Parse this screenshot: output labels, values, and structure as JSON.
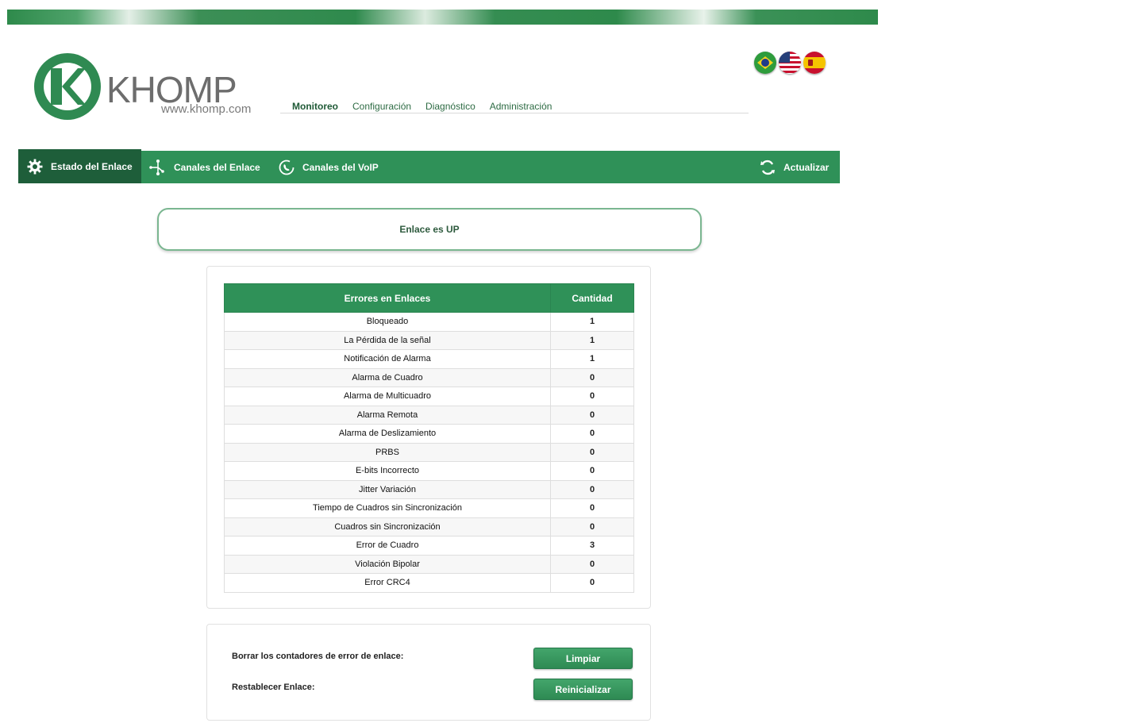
{
  "brand": {
    "name": "KHOMP",
    "url": "www.khomp.com"
  },
  "languages": [
    {
      "name": "brazil-flag-icon"
    },
    {
      "name": "usa-flag-icon"
    },
    {
      "name": "spain-flag-icon"
    }
  ],
  "main_nav": [
    {
      "label": "Monitoreo",
      "active": true
    },
    {
      "label": "Configuración"
    },
    {
      "label": "Diagnóstico"
    },
    {
      "label": "Administración"
    }
  ],
  "sub_nav": {
    "tabs": [
      {
        "label": "Estado del Enlace",
        "icon": "gear-icon",
        "active": true
      },
      {
        "label": "Canales del Enlace",
        "icon": "branch-icon"
      },
      {
        "label": "Canales del VoIP",
        "icon": "phone-cycle-icon"
      }
    ],
    "refresh_label": "Actualizar",
    "refresh_icon": "refresh-icon"
  },
  "status": {
    "text": "Enlace es UP"
  },
  "errors_table": {
    "headers": [
      "Errores en Enlaces",
      "Cantidad"
    ],
    "rows": [
      {
        "name": "Bloqueado",
        "count": "1"
      },
      {
        "name": "La Pérdida de la señal",
        "count": "1"
      },
      {
        "name": "Notificación de Alarma",
        "count": "1"
      },
      {
        "name": "Alarma de Cuadro",
        "count": "0"
      },
      {
        "name": "Alarma de Multicuadro",
        "count": "0"
      },
      {
        "name": "Alarma Remota",
        "count": "0"
      },
      {
        "name": "Alarma de Deslizamiento",
        "count": "0"
      },
      {
        "name": "PRBS",
        "count": "0"
      },
      {
        "name": "E-bits Incorrecto",
        "count": "0"
      },
      {
        "name": "Jitter Variación",
        "count": "0"
      },
      {
        "name": "Tiempo de Cuadros sin Sincronización",
        "count": "0"
      },
      {
        "name": "Cuadros sin Sincronización",
        "count": "0"
      },
      {
        "name": "Error de Cuadro",
        "count": "3"
      },
      {
        "name": "Violación Bipolar",
        "count": "0"
      },
      {
        "name": "Error CRC4",
        "count": "0"
      }
    ]
  },
  "actions": {
    "clear_label": "Borrar los contadores de error de enlace:",
    "clear_button": "Limpiar",
    "reset_label": "Restablecer Enlace:",
    "reset_button": "Reinicializar"
  },
  "colors": {
    "brand_green": "#2f9158",
    "active_tab": "#1e5e3a"
  }
}
